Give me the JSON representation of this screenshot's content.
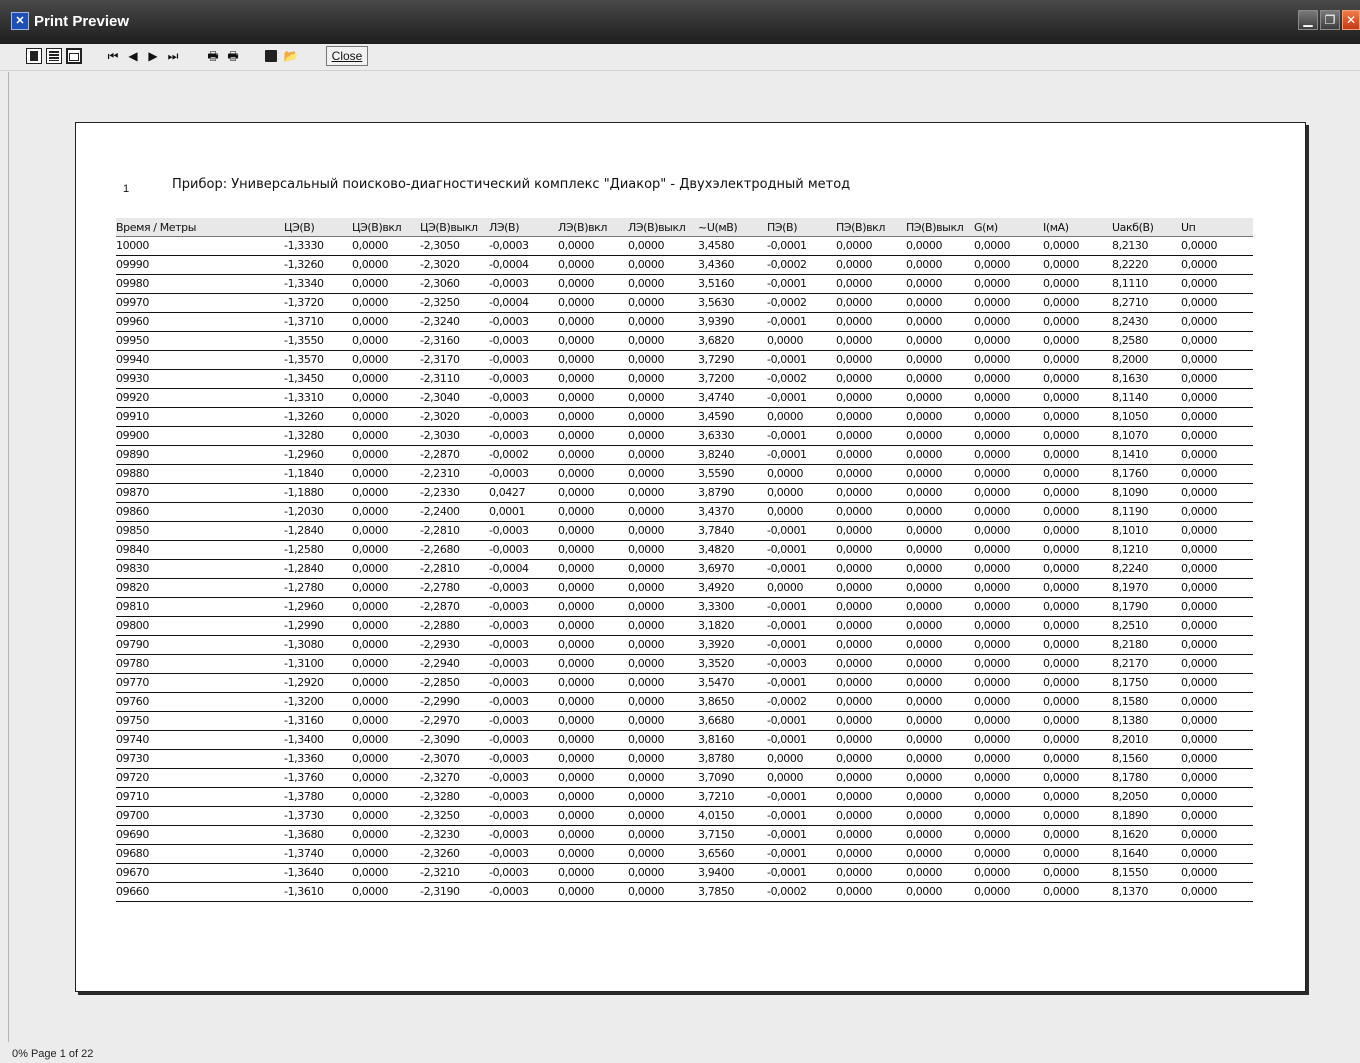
{
  "window": {
    "title": "Print Preview"
  },
  "toolbar": {
    "close_label": "Close"
  },
  "report": {
    "page_number": "1",
    "title": "Прибор: Универсальный поисково-диагностический комплекс \"Диакор\" - Двухэлектродный метод"
  },
  "table": {
    "columns": [
      "Время / Метры",
      "ЦЭ(В)",
      "ЦЭ(В)вкл",
      "ЦЭ(В)выкл",
      "ЛЭ(В)",
      "ЛЭ(В)вкл",
      "ЛЭ(В)выкл",
      "~U(мВ)",
      "ПЭ(В)",
      "ПЭ(В)вкл",
      "ПЭ(В)выкл",
      "G(м)",
      "I(мА)",
      "Uакб(В)",
      "Uп"
    ],
    "rows": [
      [
        "10000",
        "-1,3330",
        "0,0000",
        "-2,3050",
        "-0,0003",
        "0,0000",
        "0,0000",
        "3,4580",
        "-0,0001",
        "0,0000",
        "0,0000",
        "0,0000",
        "0,0000",
        "8,2130",
        "0,0000"
      ],
      [
        "09990",
        "-1,3260",
        "0,0000",
        "-2,3020",
        "-0,0004",
        "0,0000",
        "0,0000",
        "3,4360",
        "-0,0002",
        "0,0000",
        "0,0000",
        "0,0000",
        "0,0000",
        "8,2220",
        "0,0000"
      ],
      [
        "09980",
        "-1,3340",
        "0,0000",
        "-2,3060",
        "-0,0003",
        "0,0000",
        "0,0000",
        "3,5160",
        "-0,0001",
        "0,0000",
        "0,0000",
        "0,0000",
        "0,0000",
        "8,1110",
        "0,0000"
      ],
      [
        "09970",
        "-1,3720",
        "0,0000",
        "-2,3250",
        "-0,0004",
        "0,0000",
        "0,0000",
        "3,5630",
        "-0,0002",
        "0,0000",
        "0,0000",
        "0,0000",
        "0,0000",
        "8,2710",
        "0,0000"
      ],
      [
        "09960",
        "-1,3710",
        "0,0000",
        "-2,3240",
        "-0,0003",
        "0,0000",
        "0,0000",
        "3,9390",
        "-0,0001",
        "0,0000",
        "0,0000",
        "0,0000",
        "0,0000",
        "8,2430",
        "0,0000"
      ],
      [
        "09950",
        "-1,3550",
        "0,0000",
        "-2,3160",
        "-0,0003",
        "0,0000",
        "0,0000",
        "3,6820",
        "0,0000",
        "0,0000",
        "0,0000",
        "0,0000",
        "0,0000",
        "8,2580",
        "0,0000"
      ],
      [
        "09940",
        "-1,3570",
        "0,0000",
        "-2,3170",
        "-0,0003",
        "0,0000",
        "0,0000",
        "3,7290",
        "-0,0001",
        "0,0000",
        "0,0000",
        "0,0000",
        "0,0000",
        "8,2000",
        "0,0000"
      ],
      [
        "09930",
        "-1,3450",
        "0,0000",
        "-2,3110",
        "-0,0003",
        "0,0000",
        "0,0000",
        "3,7200",
        "-0,0002",
        "0,0000",
        "0,0000",
        "0,0000",
        "0,0000",
        "8,1630",
        "0,0000"
      ],
      [
        "09920",
        "-1,3310",
        "0,0000",
        "-2,3040",
        "-0,0003",
        "0,0000",
        "0,0000",
        "3,4740",
        "-0,0001",
        "0,0000",
        "0,0000",
        "0,0000",
        "0,0000",
        "8,1140",
        "0,0000"
      ],
      [
        "09910",
        "-1,3260",
        "0,0000",
        "-2,3020",
        "-0,0003",
        "0,0000",
        "0,0000",
        "3,4590",
        "0,0000",
        "0,0000",
        "0,0000",
        "0,0000",
        "0,0000",
        "8,1050",
        "0,0000"
      ],
      [
        "09900",
        "-1,3280",
        "0,0000",
        "-2,3030",
        "-0,0003",
        "0,0000",
        "0,0000",
        "3,6330",
        "-0,0001",
        "0,0000",
        "0,0000",
        "0,0000",
        "0,0000",
        "8,1070",
        "0,0000"
      ],
      [
        "09890",
        "-1,2960",
        "0,0000",
        "-2,2870",
        "-0,0002",
        "0,0000",
        "0,0000",
        "3,8240",
        "-0,0001",
        "0,0000",
        "0,0000",
        "0,0000",
        "0,0000",
        "8,1410",
        "0,0000"
      ],
      [
        "09880",
        "-1,1840",
        "0,0000",
        "-2,2310",
        "-0,0003",
        "0,0000",
        "0,0000",
        "3,5590",
        "0,0000",
        "0,0000",
        "0,0000",
        "0,0000",
        "0,0000",
        "8,1760",
        "0,0000"
      ],
      [
        "09870",
        "-1,1880",
        "0,0000",
        "-2,2330",
        "0,0427",
        "0,0000",
        "0,0000",
        "3,8790",
        "0,0000",
        "0,0000",
        "0,0000",
        "0,0000",
        "0,0000",
        "8,1090",
        "0,0000"
      ],
      [
        "09860",
        "-1,2030",
        "0,0000",
        "-2,2400",
        "0,0001",
        "0,0000",
        "0,0000",
        "3,4370",
        "0,0000",
        "0,0000",
        "0,0000",
        "0,0000",
        "0,0000",
        "8,1190",
        "0,0000"
      ],
      [
        "09850",
        "-1,2840",
        "0,0000",
        "-2,2810",
        "-0,0003",
        "0,0000",
        "0,0000",
        "3,7840",
        "-0,0001",
        "0,0000",
        "0,0000",
        "0,0000",
        "0,0000",
        "8,1010",
        "0,0000"
      ],
      [
        "09840",
        "-1,2580",
        "0,0000",
        "-2,2680",
        "-0,0003",
        "0,0000",
        "0,0000",
        "3,4820",
        "-0,0001",
        "0,0000",
        "0,0000",
        "0,0000",
        "0,0000",
        "8,1210",
        "0,0000"
      ],
      [
        "09830",
        "-1,2840",
        "0,0000",
        "-2,2810",
        "-0,0004",
        "0,0000",
        "0,0000",
        "3,6970",
        "-0,0001",
        "0,0000",
        "0,0000",
        "0,0000",
        "0,0000",
        "8,2240",
        "0,0000"
      ],
      [
        "09820",
        "-1,2780",
        "0,0000",
        "-2,2780",
        "-0,0003",
        "0,0000",
        "0,0000",
        "3,4920",
        "0,0000",
        "0,0000",
        "0,0000",
        "0,0000",
        "0,0000",
        "8,1970",
        "0,0000"
      ],
      [
        "09810",
        "-1,2960",
        "0,0000",
        "-2,2870",
        "-0,0003",
        "0,0000",
        "0,0000",
        "3,3300",
        "-0,0001",
        "0,0000",
        "0,0000",
        "0,0000",
        "0,0000",
        "8,1790",
        "0,0000"
      ],
      [
        "09800",
        "-1,2990",
        "0,0000",
        "-2,2880",
        "-0,0003",
        "0,0000",
        "0,0000",
        "3,1820",
        "-0,0001",
        "0,0000",
        "0,0000",
        "0,0000",
        "0,0000",
        "8,2510",
        "0,0000"
      ],
      [
        "09790",
        "-1,3080",
        "0,0000",
        "-2,2930",
        "-0,0003",
        "0,0000",
        "0,0000",
        "3,3920",
        "-0,0001",
        "0,0000",
        "0,0000",
        "0,0000",
        "0,0000",
        "8,2180",
        "0,0000"
      ],
      [
        "09780",
        "-1,3100",
        "0,0000",
        "-2,2940",
        "-0,0003",
        "0,0000",
        "0,0000",
        "3,3520",
        "-0,0003",
        "0,0000",
        "0,0000",
        "0,0000",
        "0,0000",
        "8,2170",
        "0,0000"
      ],
      [
        "09770",
        "-1,2920",
        "0,0000",
        "-2,2850",
        "-0,0003",
        "0,0000",
        "0,0000",
        "3,5470",
        "-0,0001",
        "0,0000",
        "0,0000",
        "0,0000",
        "0,0000",
        "8,1750",
        "0,0000"
      ],
      [
        "09760",
        "-1,3200",
        "0,0000",
        "-2,2990",
        "-0,0003",
        "0,0000",
        "0,0000",
        "3,8650",
        "-0,0002",
        "0,0000",
        "0,0000",
        "0,0000",
        "0,0000",
        "8,1580",
        "0,0000"
      ],
      [
        "09750",
        "-1,3160",
        "0,0000",
        "-2,2970",
        "-0,0003",
        "0,0000",
        "0,0000",
        "3,6680",
        "-0,0001",
        "0,0000",
        "0,0000",
        "0,0000",
        "0,0000",
        "8,1380",
        "0,0000"
      ],
      [
        "09740",
        "-1,3400",
        "0,0000",
        "-2,3090",
        "-0,0003",
        "0,0000",
        "0,0000",
        "3,8160",
        "-0,0001",
        "0,0000",
        "0,0000",
        "0,0000",
        "0,0000",
        "8,2010",
        "0,0000"
      ],
      [
        "09730",
        "-1,3360",
        "0,0000",
        "-2,3070",
        "-0,0003",
        "0,0000",
        "0,0000",
        "3,8780",
        "0,0000",
        "0,0000",
        "0,0000",
        "0,0000",
        "0,0000",
        "8,1560",
        "0,0000"
      ],
      [
        "09720",
        "-1,3760",
        "0,0000",
        "-2,3270",
        "-0,0003",
        "0,0000",
        "0,0000",
        "3,7090",
        "0,0000",
        "0,0000",
        "0,0000",
        "0,0000",
        "0,0000",
        "8,1780",
        "0,0000"
      ],
      [
        "09710",
        "-1,3780",
        "0,0000",
        "-2,3280",
        "-0,0003",
        "0,0000",
        "0,0000",
        "3,7210",
        "-0,0001",
        "0,0000",
        "0,0000",
        "0,0000",
        "0,0000",
        "8,2050",
        "0,0000"
      ],
      [
        "09700",
        "-1,3730",
        "0,0000",
        "-2,3250",
        "-0,0003",
        "0,0000",
        "0,0000",
        "4,0150",
        "-0,0001",
        "0,0000",
        "0,0000",
        "0,0000",
        "0,0000",
        "8,1890",
        "0,0000"
      ],
      [
        "09690",
        "-1,3680",
        "0,0000",
        "-2,3230",
        "-0,0003",
        "0,0000",
        "0,0000",
        "3,7150",
        "-0,0001",
        "0,0000",
        "0,0000",
        "0,0000",
        "0,0000",
        "8,1620",
        "0,0000"
      ],
      [
        "09680",
        "-1,3740",
        "0,0000",
        "-2,3260",
        "-0,0003",
        "0,0000",
        "0,0000",
        "3,6560",
        "-0,0001",
        "0,0000",
        "0,0000",
        "0,0000",
        "0,0000",
        "8,1640",
        "0,0000"
      ],
      [
        "09670",
        "-1,3640",
        "0,0000",
        "-2,3210",
        "-0,0003",
        "0,0000",
        "0,0000",
        "3,9400",
        "-0,0001",
        "0,0000",
        "0,0000",
        "0,0000",
        "0,0000",
        "8,1550",
        "0,0000"
      ],
      [
        "09660",
        "-1,3610",
        "0,0000",
        "-2,3190",
        "-0,0003",
        "0,0000",
        "0,0000",
        "3,7850",
        "-0,0002",
        "0,0000",
        "0,0000",
        "0,0000",
        "0,0000",
        "8,1370",
        "0,0000"
      ]
    ]
  },
  "status": {
    "text": "0%  Page 1 of 22"
  },
  "icons": {
    "toolbar": [
      "one-page-icon",
      "two-pages-icon",
      "page-width-icon",
      "first-page-icon",
      "prev-page-icon",
      "next-page-icon",
      "last-page-icon",
      "print-setup-icon",
      "print-icon",
      "save-icon",
      "open-icon"
    ],
    "window": [
      "minimize-icon",
      "restore-icon",
      "close-icon"
    ]
  }
}
